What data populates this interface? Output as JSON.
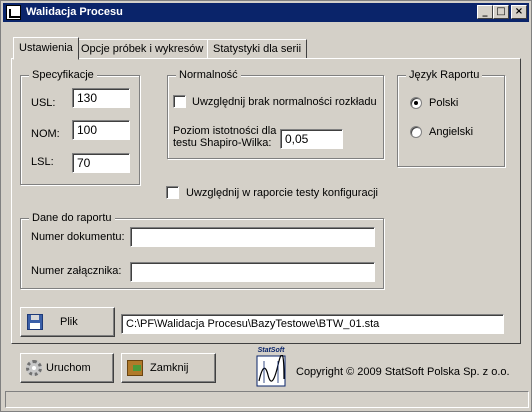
{
  "window": {
    "title": "Walidacja Procesu"
  },
  "titlebar_buttons": {
    "minimize": "_",
    "maximize": "□",
    "close": "×"
  },
  "tabs": [
    {
      "label": "Ustawienia",
      "active": true
    },
    {
      "label": "Opcje próbek i wykresów",
      "active": false
    },
    {
      "label": "Statystyki dla serii",
      "active": false
    }
  ],
  "specyfikacje": {
    "legend": "Specyfikacje",
    "usl": {
      "label": "USL:",
      "value": "130"
    },
    "nom": {
      "label": "NOM:",
      "value": "100"
    },
    "lsl": {
      "label": "LSL:",
      "value": "70"
    }
  },
  "normalnosc": {
    "legend": "Normalność",
    "checkbox_label": "Uwzględnij brak normalności rozkładu",
    "checkbox_checked": false,
    "poziom_label_line1": "Poziom istotności dla",
    "poziom_label_line2": "testu Shapiro-Wilka:",
    "poziom_value": "0,05"
  },
  "jezyk": {
    "legend": "Język Raportu",
    "options": [
      {
        "label": "Polski",
        "checked": true
      },
      {
        "label": "Angielski",
        "checked": false
      }
    ]
  },
  "testy_konfiguracji": {
    "label": "Uwzględnij w raporcie testy konfiguracji",
    "checked": false
  },
  "dane_do_raportu": {
    "legend": "Dane do raportu",
    "numer_dokumentu": {
      "label": "Numer dokumentu:",
      "value": ""
    },
    "numer_zalacznika": {
      "label": "Numer załącznika:",
      "value": ""
    }
  },
  "plik": {
    "button_label": "Plik",
    "path": "C:\\PF\\Walidacja Procesu\\BazyTestowe\\BTW_01.sta"
  },
  "actions": {
    "run_label": "Uruchom",
    "close_label": "Zamknij"
  },
  "logo_text": "StatSoft",
  "copyright": "Copyright © 2009 StatSoft Polska Sp. z o.o.",
  "icons": {
    "file": "floppy-disk-icon",
    "run": "gear-icon",
    "close": "exit-door-icon",
    "logo": "statsoft-logo-icon"
  }
}
